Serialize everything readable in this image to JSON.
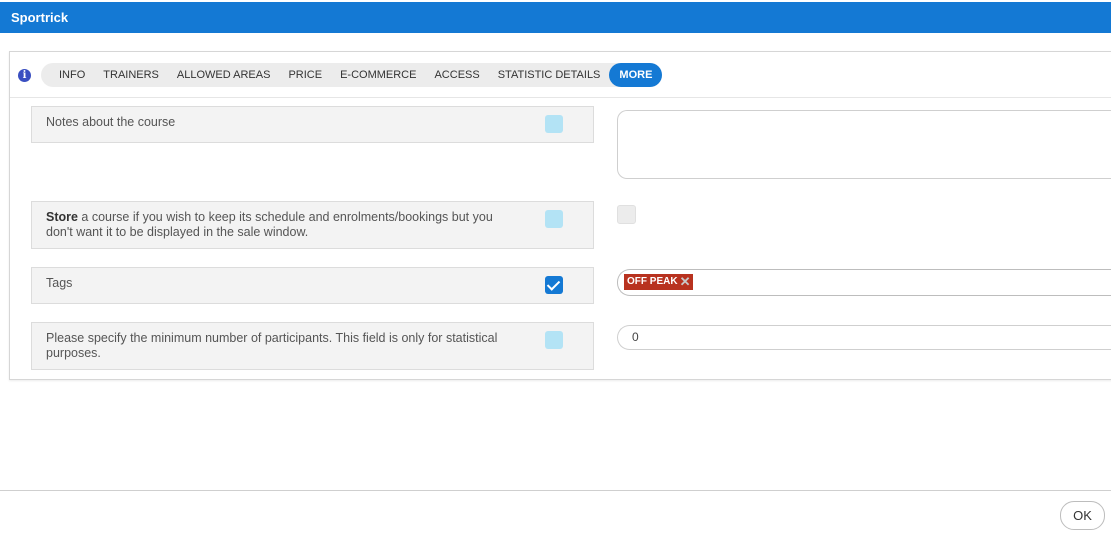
{
  "app": {
    "title": "Sportrick"
  },
  "tabs": [
    {
      "label": "INFO"
    },
    {
      "label": "TRAINERS"
    },
    {
      "label": "ALLOWED AREAS"
    },
    {
      "label": "PRICE"
    },
    {
      "label": "E-COMMERCE"
    },
    {
      "label": "ACCESS"
    },
    {
      "label": "STATISTIC DETAILS"
    },
    {
      "label": "MORE",
      "active": true
    }
  ],
  "rows": {
    "notes": {
      "label": "Notes about the course",
      "value": ""
    },
    "store": {
      "label_bold": "Store",
      "label_rest": " a course if you wish to keep its schedule and enrolments/bookings but you don't want it to be displayed in the sale window.",
      "checked": false
    },
    "tags": {
      "label": "Tags",
      "tag": "OFF PEAK",
      "remove_glyph": "✕"
    },
    "min_participants": {
      "label": "Please specify the minimum number of participants. This field is only for statistical purposes.",
      "value": "0"
    }
  },
  "footer": {
    "ok_label": "OK"
  },
  "icons": {
    "info": "info-icon",
    "check": "checkmark-icon",
    "remove": "close-icon"
  },
  "colors": {
    "accent": "#1479d4",
    "tag": "#b8321f",
    "help_toggle": "#b3e3f5"
  }
}
